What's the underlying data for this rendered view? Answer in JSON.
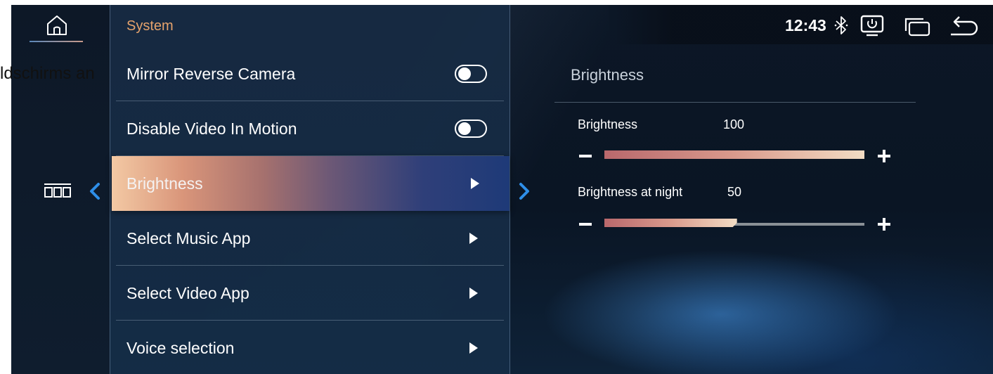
{
  "overlay_text": "ldschirms an",
  "status_bar": {
    "time": "12:43",
    "icons": [
      "bluetooth-icon",
      "screen-power-icon",
      "window-icon",
      "return-icon"
    ]
  },
  "left_rail": {
    "icons": [
      "home-icon",
      "apps-icon",
      "back-chevron-icon"
    ]
  },
  "menu": {
    "title": "System",
    "items": [
      {
        "label": "Mirror Reverse Camera",
        "control": "toggle",
        "state": "off"
      },
      {
        "label": "Disable Video In Motion",
        "control": "toggle",
        "state": "off"
      },
      {
        "label": "Brightness",
        "control": "arrow",
        "selected": true
      },
      {
        "label": "Select Music App",
        "control": "arrow"
      },
      {
        "label": "Select Video App",
        "control": "arrow"
      },
      {
        "label": "Voice selection",
        "control": "arrow"
      }
    ]
  },
  "detail": {
    "title": "Brightness",
    "sliders": [
      {
        "label": "Brightness",
        "value": "100",
        "level": 1.0
      },
      {
        "label": "Brightness at night",
        "value": "50",
        "level": 0.51
      }
    ]
  },
  "colors": {
    "accent_title": "#e6a36c",
    "selected_gradient_start": "#f3c9a4",
    "selected_gradient_end": "#1e3a78",
    "chevron_blue": "#2e8ee8"
  }
}
